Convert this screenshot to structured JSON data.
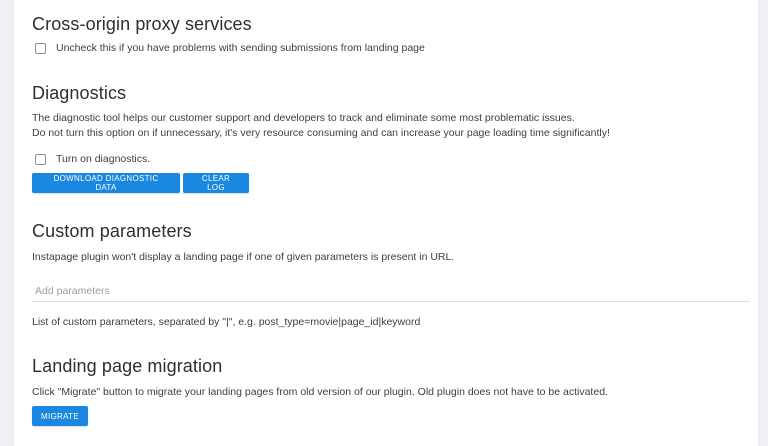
{
  "proxy": {
    "title": "Cross-origin proxy services",
    "checkbox_label": "Uncheck this if you have problems with sending submissions from landing page"
  },
  "diagnostics": {
    "title": "Diagnostics",
    "description_line1": "The diagnostic tool helps our customer support and developers to track and eliminate some most problematic issues.",
    "description_line2": "Do not turn this option on if unnecessary, it's very resource consuming and can increase your page loading time significantly!",
    "checkbox_label": "Turn on diagnostics.",
    "download_button": "Download diagnostic data",
    "clear_button": "Clear log"
  },
  "custom_parameters": {
    "title": "Custom parameters",
    "description": "Instapage plugin won't display a landing page if one of given parameters is present in URL.",
    "input_placeholder": "Add parameters",
    "input_value": "",
    "hint": "List of custom parameters, separated by \"|\", e.g. post_type=movie|page_id|keyword"
  },
  "migration": {
    "title": "Landing page migration",
    "description": "Click \"Migrate\" button to migrate your landing pages from old version of our plugin. Old plugin does not have to be activated.",
    "migrate_button": "Migrate"
  },
  "colors": {
    "primary_button": "#1a87e0",
    "page_background": "#eef0f3",
    "panel_background": "#ffffff"
  }
}
